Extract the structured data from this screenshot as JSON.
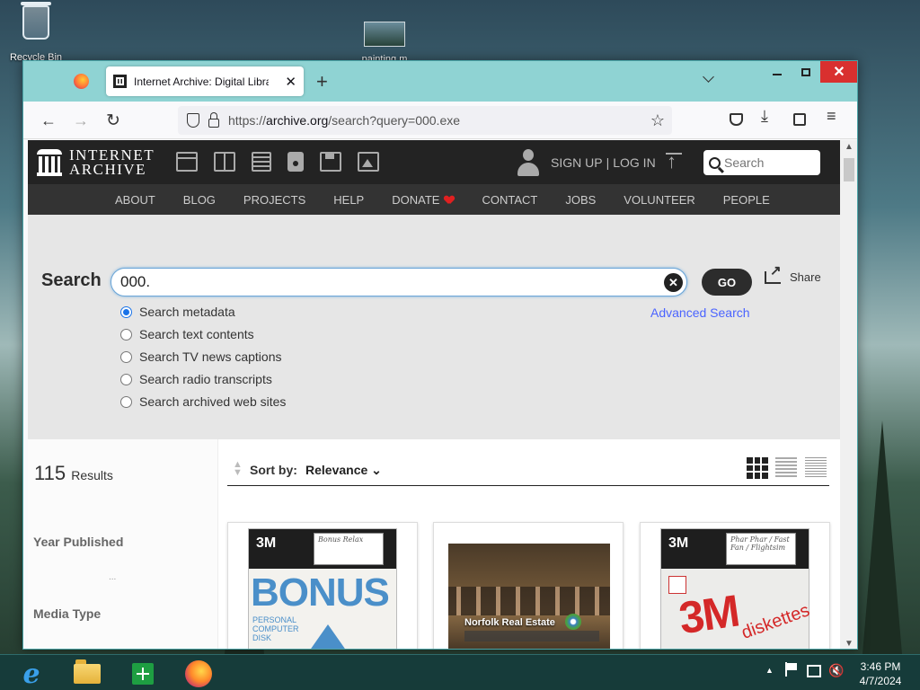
{
  "desktop": {
    "recycle_bin_label": "Recycle Bin",
    "painting_label": "painting.m"
  },
  "browser": {
    "tab_title": "Internet Archive: Digital Library",
    "tab_close": "✕",
    "new_tab": "+",
    "win_close": "✕",
    "url_prefix": "https://",
    "url_domain": "archive.org",
    "url_path": "/search?query=000.exe",
    "back_icon": "←",
    "forward_icon": "→",
    "reload_icon": "↻",
    "star_icon": "☆"
  },
  "ia_header": {
    "logo_line1": "INTERNET",
    "logo_line2": "ARCHIVE",
    "sign_up": "SIGN UP",
    "separator": "|",
    "log_in": "LOG IN",
    "search_placeholder": "Search"
  },
  "subnav": {
    "items": [
      "ABOUT",
      "BLOG",
      "PROJECTS",
      "HELP",
      "DONATE",
      "CONTACT",
      "JOBS",
      "VOLUNTEER",
      "PEOPLE"
    ]
  },
  "search": {
    "label": "Search",
    "query_value": "000.",
    "clear_label": "✕",
    "go_label": "GO",
    "share_label": "Share",
    "advanced_label": "Advanced Search",
    "options": [
      "Search metadata",
      "Search text contents",
      "Search TV news captions",
      "Search radio transcripts",
      "Search archived web sites"
    ],
    "selected_option": 0
  },
  "results": {
    "count": "115",
    "count_label": "Results",
    "facets": [
      "Year Published",
      "Media Type"
    ],
    "facet_dots": "...",
    "sort_by_label": "Sort by:",
    "sort_value": "Relevance ⌄",
    "cards": [
      {
        "brand": "3M",
        "title": "BONUS",
        "sub1": "PERSONAL",
        "sub2": "COMPUTER",
        "sub3": "DISK",
        "label_text": "Bonus Relax"
      },
      {
        "caption": "Norfolk Real Estate"
      },
      {
        "brand": "3M",
        "big": "3M",
        "word": "diskettes",
        "label_text": "Phar Phar / Fast Fan / Flightsim"
      }
    ]
  },
  "taskbar": {
    "ie_glyph": "e",
    "tray_up": "▲",
    "volume_icon": "🔇",
    "time": "3:46 PM",
    "date": "4/7/2024"
  },
  "colors": {
    "ia_top": "#232323",
    "ia_subnav": "#333333",
    "search_bg": "#e6e6e6",
    "link_blue": "#4b64ff",
    "radio_blue": "#1a73e8",
    "close_red": "#d9302f",
    "tabstrip": "#8fd3d3"
  }
}
